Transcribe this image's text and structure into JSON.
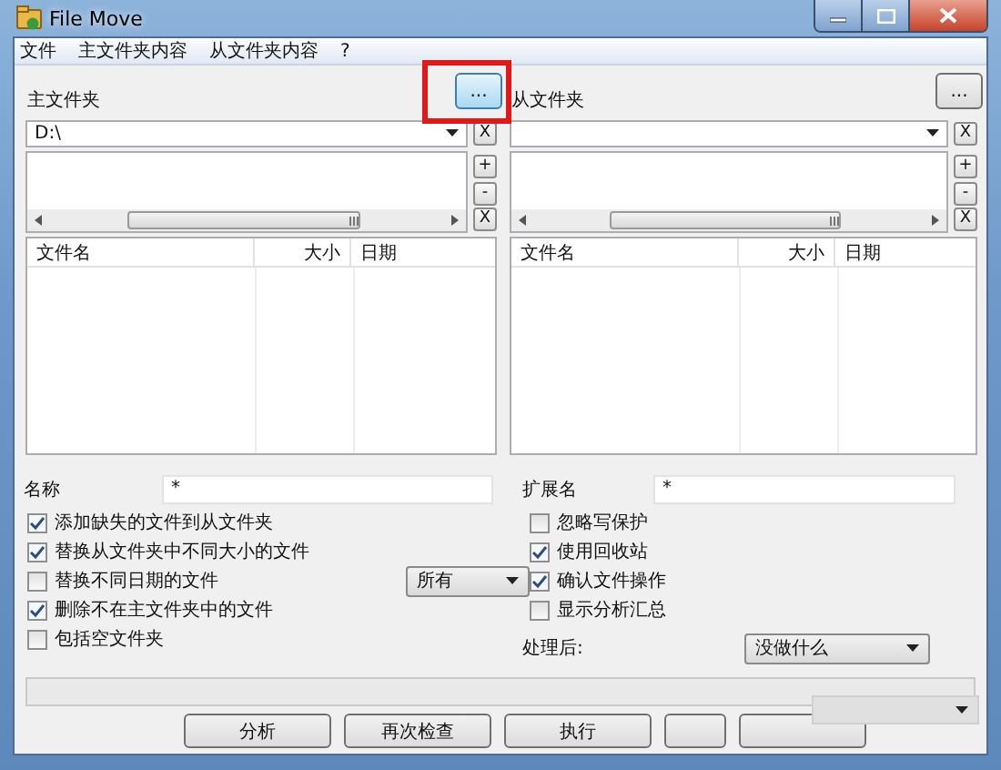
{
  "window": {
    "title": "File Move"
  },
  "menu": [
    {
      "label": "文件"
    },
    {
      "label": "主文件夹内容"
    },
    {
      "label": "从文件夹内容"
    },
    {
      "label": "?"
    }
  ],
  "panels": [
    {
      "label": "主文件夹",
      "browse_button": "...",
      "highlighted": true,
      "path": "D:\\",
      "clear_button": "X",
      "add_button": "+",
      "remove_button": "-",
      "clear_list_button": "X",
      "columns": [
        "文件名",
        "大小",
        "日期"
      ]
    },
    {
      "label": "从文件夹",
      "browse_button": "...",
      "highlighted": false,
      "clear_button": "X",
      "add_button": "+",
      "remove_button": "-",
      "clear_list_button": "X",
      "columns": [
        "文件名",
        "大小",
        "日期"
      ]
    }
  ],
  "filters": [
    {
      "label": "名称",
      "value": "*"
    },
    {
      "label": "扩展名",
      "value": "*"
    }
  ],
  "left_options": [
    {
      "label": "添加缺失的文件到从文件夹",
      "checked": true
    },
    {
      "label": "替换从文件夹中不同大小的文件",
      "checked": true
    },
    {
      "label": "替换不同日期的文件",
      "checked": false,
      "dropdown": "所有"
    },
    {
      "label": "删除不在主文件夹中的文件",
      "checked": true
    },
    {
      "label": "包括空文件夹",
      "checked": false
    }
  ],
  "right_options": [
    {
      "label": "忽略写保护",
      "checked": false
    },
    {
      "label": "使用回收站",
      "checked": true
    },
    {
      "label": "确认文件操作",
      "checked": true
    },
    {
      "label": "显示分析汇总",
      "checked": false
    }
  ],
  "after": {
    "label": "处理后:",
    "value": "没做什么"
  },
  "buttons": [
    {
      "kind": "text",
      "label": "分析"
    },
    {
      "kind": "text",
      "label": "再次检查"
    },
    {
      "kind": "text",
      "label": "执行"
    },
    {
      "kind": "blank"
    },
    {
      "kind": "blank"
    }
  ]
}
